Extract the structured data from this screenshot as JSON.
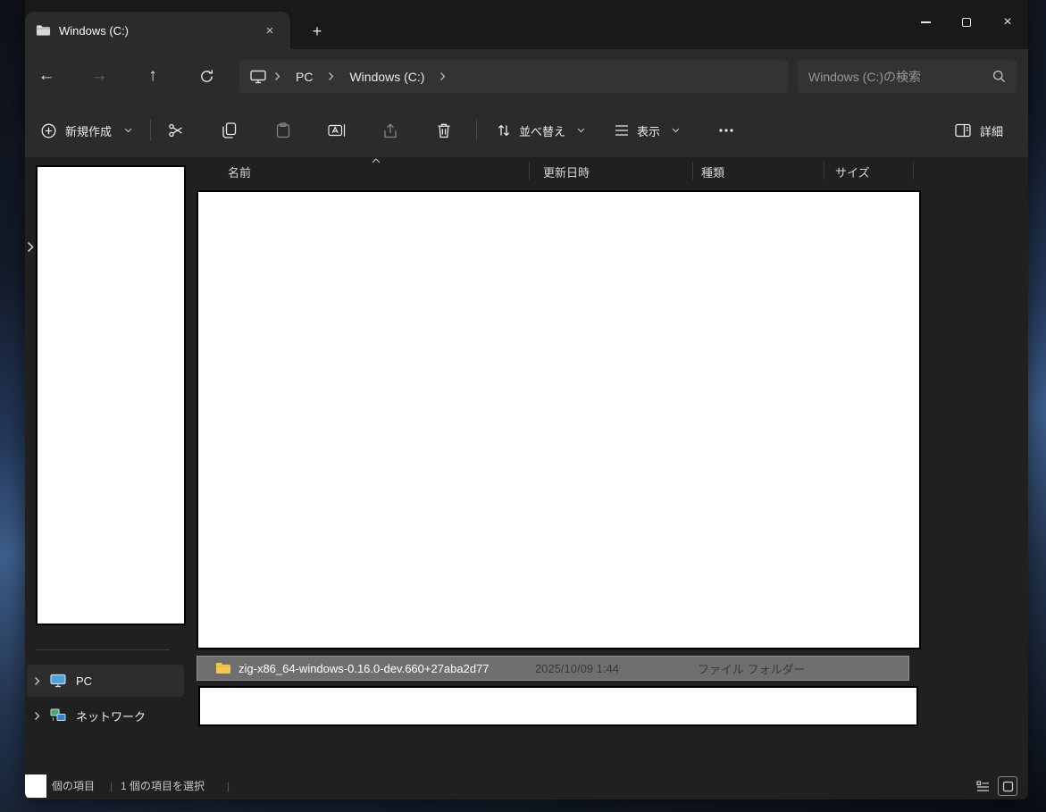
{
  "titlebar": {
    "tab_title": "Windows (C:)"
  },
  "icons": {
    "tab_close": "×",
    "new_tab": "+",
    "close": "×",
    "back": "←",
    "forward": "→",
    "up": "↑"
  },
  "nav": {
    "breadcrumb": [
      "PC",
      "Windows (C:)"
    ],
    "search_placeholder": "Windows (C:)の検索"
  },
  "toolbar": {
    "new": "新規作成",
    "sort": "並べ替え",
    "view": "表示",
    "details": "詳細"
  },
  "columns": [
    "名前",
    "更新日時",
    "種類",
    "サイズ"
  ],
  "sidebar": [
    {
      "label": "PC"
    },
    {
      "label": "ネットワーク"
    }
  ],
  "files": [
    {
      "name": "zig-x86_64-windows-0.16.0-dev.660+27aba2d77",
      "date": "2025/10/09 1:44",
      "type": "ファイル フォルダー",
      "size": ""
    }
  ],
  "statusbar": {
    "count_suffix": "個の項目",
    "selection": "1 個の項目を選択"
  },
  "colors": {
    "selection_bg": "#6f6f6f",
    "folder_yellow": "#f6c84c",
    "window_bg": "#202020",
    "bar_bg": "#2b2b2b"
  }
}
